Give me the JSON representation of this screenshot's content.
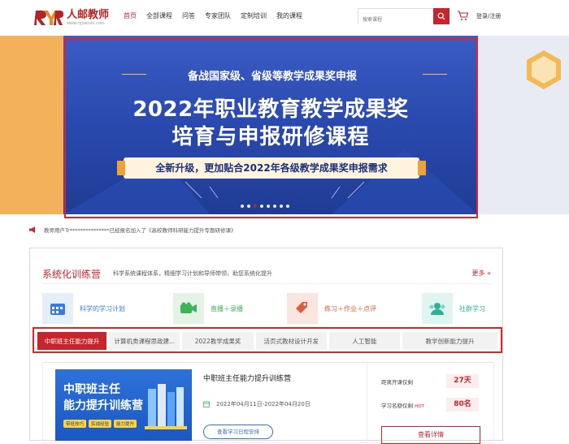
{
  "brand": {
    "name": "人邮教师",
    "url": "www.ryjiaoshi.com",
    "color": "#c8242c"
  },
  "nav": {
    "items": [
      "首页",
      "全部课程",
      "问答",
      "专家团队",
      "定制培训",
      "我的课程"
    ],
    "active_index": 0
  },
  "search": {
    "placeholder": "搜索课程",
    "icon": "search-icon"
  },
  "header": {
    "cart_icon": "cart-icon",
    "login_label": "登录/注册"
  },
  "banner": {
    "subtitle": "备战国家级、省级等教学成果奖申报",
    "title_line1": "2022年职业教育教学成果奖",
    "title_line2": "培育与申报研修课程",
    "pill": "全新升级，更加贴合2022年各级教学成果奖申报需求",
    "dots_count": 8,
    "active_dot": 2
  },
  "notice": {
    "icon": "speaker-icon",
    "text": "教师用户Tr***************已经报名加入了《高校教师科研能力提升专题研修课》"
  },
  "section": {
    "title": "系统化训练营",
    "description": "科学系统课程体系，精细学习计划和导师带领，助您系统化提升",
    "more_label": "更多",
    "features": [
      {
        "label": "科学的学习计划",
        "icon": "calendar-icon",
        "bg": "#e6eef9",
        "color": "#3a7be0"
      },
      {
        "label": "直播＋录播",
        "icon": "video-camera-icon",
        "bg": "#e3f4e6",
        "color": "#3fb25a"
      },
      {
        "label": "练习＋作业＋点评",
        "icon": "tag-icon",
        "bg": "#fbe6df",
        "color": "#e25a3a"
      },
      {
        "label": "社群学习",
        "icon": "group-icon",
        "bg": "#e0f4f1",
        "color": "#2db09a"
      }
    ],
    "tabs": [
      "中职班主任能力提升",
      "计算机类课程思政建...",
      "2022教学成果奖",
      "活页式教材设计开发",
      "人工智能",
      "教学创新能力提升"
    ],
    "active_tab": 0
  },
  "course": {
    "thumb_line1": "中职班主任",
    "thumb_line2": "能力提升训练营",
    "thumb_tags": [
      "带班技巧",
      "实战经验",
      "能力提升"
    ],
    "title": "中职班主任能力提升训练营",
    "date_icon": "calendar-icon",
    "date": "2022年04月11日-2022年04月20日",
    "schedule_button": "查看学习日程安排",
    "countdown_label": "距离开课仅剩",
    "countdown_value": "27天",
    "quota_label": "学习名额仅剩",
    "quota_hot": "HOT",
    "quota_value": "80名",
    "detail_button": "查看详情"
  }
}
